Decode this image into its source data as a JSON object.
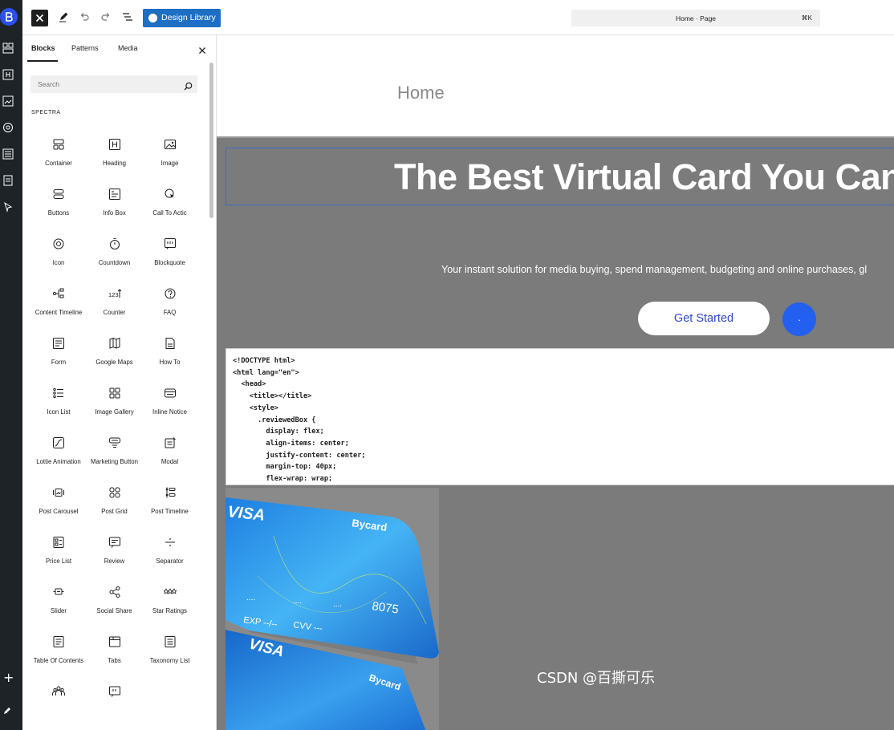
{
  "toolbar": {
    "design_library_label": "Design Library",
    "document_title": "Home · Page",
    "shortcut": "⌘K"
  },
  "inserter": {
    "tabs": [
      "Blocks",
      "Patterns",
      "Media"
    ],
    "active_tab": "Blocks",
    "search_placeholder": "Search",
    "section_label": "SPECTRA",
    "blocks": [
      {
        "label": "Container",
        "icon": "container-icon"
      },
      {
        "label": "Heading",
        "icon": "heading-icon"
      },
      {
        "label": "Image",
        "icon": "image-icon"
      },
      {
        "label": "Buttons",
        "icon": "buttons-icon"
      },
      {
        "label": "Info Box",
        "icon": "info-box-icon"
      },
      {
        "label": "Call To Actic",
        "icon": "call-to-action-icon"
      },
      {
        "label": "Icon",
        "icon": "icon-icon"
      },
      {
        "label": "Countdown",
        "icon": "countdown-icon"
      },
      {
        "label": "Blockquote",
        "icon": "blockquote-icon"
      },
      {
        "label": "Content Timeline",
        "icon": "content-timeline-icon"
      },
      {
        "label": "Counter",
        "icon": "counter-icon"
      },
      {
        "label": "FAQ",
        "icon": "faq-icon"
      },
      {
        "label": "Form",
        "icon": "form-icon"
      },
      {
        "label": "Google Maps",
        "icon": "google-maps-icon"
      },
      {
        "label": "How To",
        "icon": "how-to-icon"
      },
      {
        "label": "Icon List",
        "icon": "icon-list-icon"
      },
      {
        "label": "Image Gallery",
        "icon": "image-gallery-icon"
      },
      {
        "label": "Inline Notice",
        "icon": "inline-notice-icon"
      },
      {
        "label": "Lottie Animation",
        "icon": "lottie-animation-icon"
      },
      {
        "label": "Marketing Button",
        "icon": "marketing-button-icon"
      },
      {
        "label": "Modal",
        "icon": "modal-icon"
      },
      {
        "label": "Post Carousel",
        "icon": "post-carousel-icon"
      },
      {
        "label": "Post Grid",
        "icon": "post-grid-icon"
      },
      {
        "label": "Post Timeline",
        "icon": "post-timeline-icon"
      },
      {
        "label": "Price List",
        "icon": "price-list-icon"
      },
      {
        "label": "Review",
        "icon": "review-icon"
      },
      {
        "label": "Separator",
        "icon": "separator-icon"
      },
      {
        "label": "Slider",
        "icon": "slider-icon"
      },
      {
        "label": "Social Share",
        "icon": "social-share-icon"
      },
      {
        "label": "Star Ratings",
        "icon": "star-ratings-icon"
      },
      {
        "label": "Table Of Contents",
        "icon": "table-of-contents-icon"
      },
      {
        "label": "Tabs",
        "icon": "tabs-icon"
      },
      {
        "label": "Taxonomy List",
        "icon": "taxonomy-list-icon"
      },
      {
        "label": "",
        "icon": "team-icon"
      },
      {
        "label": "",
        "icon": "testimonial-icon"
      }
    ]
  },
  "canvas": {
    "page_title": "Home",
    "hero_heading": "The Best Virtual Card You Can",
    "hero_subtitle": "Your instant solution for media buying, spend management, budgeting and online purchases, gl",
    "cta_label": "Get Started",
    "circle_button_label": ".",
    "code_lines": [
      "<!DOCTYPE html>",
      "<html lang=\"en\">",
      "  <head>",
      "    <title></title>",
      "    <style>",
      "      .reviewedBox {",
      "        display: flex;",
      "        align-items: center;",
      "        justify-content: center;",
      "        margin-top: 40px;",
      "        flex-wrap: wrap;"
    ],
    "card_image": {
      "front_brand": "Bycard",
      "front_network": "VISA",
      "front_number_groups": [
        "....",
        "....",
        "....",
        "8075"
      ],
      "front_exp": "EXP --/--",
      "front_cvv": "CVV ---",
      "back_brand": "Bycard",
      "back_network": "VISA"
    }
  },
  "watermark": "CSDN @百撕可乐",
  "colors": {
    "accent": "#2360ef",
    "design_library": "#1d6fc4",
    "hero_bg": "#7b7b7b",
    "admin_bar": "#1d2327"
  }
}
